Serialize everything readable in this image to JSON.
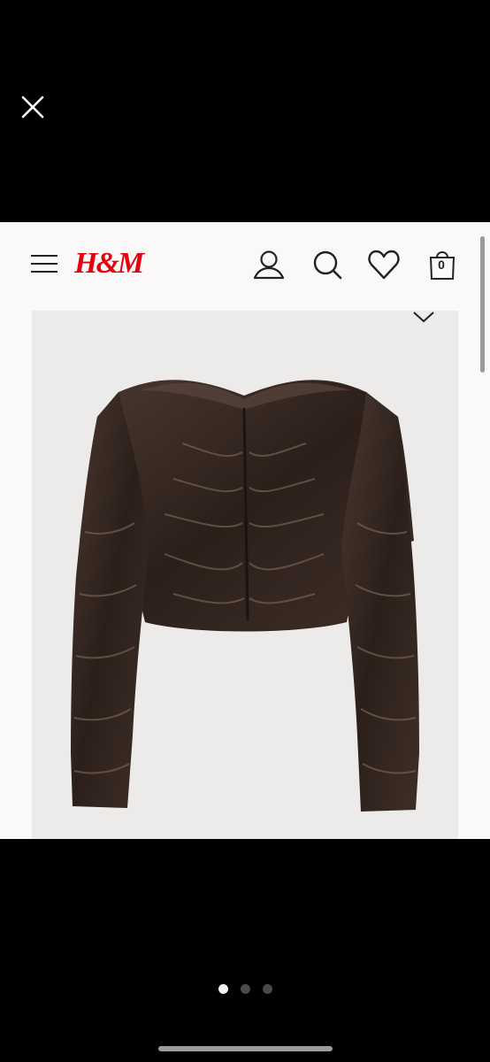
{
  "viewer": {
    "close_icon": "close-icon",
    "page_count": 3,
    "active_page": 1
  },
  "site": {
    "menu_icon": "hamburger-menu-icon",
    "logo_text": "H&M",
    "brand_color": "#e50010",
    "account_icon": "user-icon",
    "search_icon": "search-icon",
    "favorites_icon": "heart-icon",
    "bag_icon": "shopping-bag-icon",
    "bag_count": "0"
  },
  "product": {
    "image_description_icon": "satin-ruched-top-image",
    "garment_color": "#3a2a24",
    "background_color": "#ecebea",
    "dropdown_icon": "chevron-down-icon"
  }
}
